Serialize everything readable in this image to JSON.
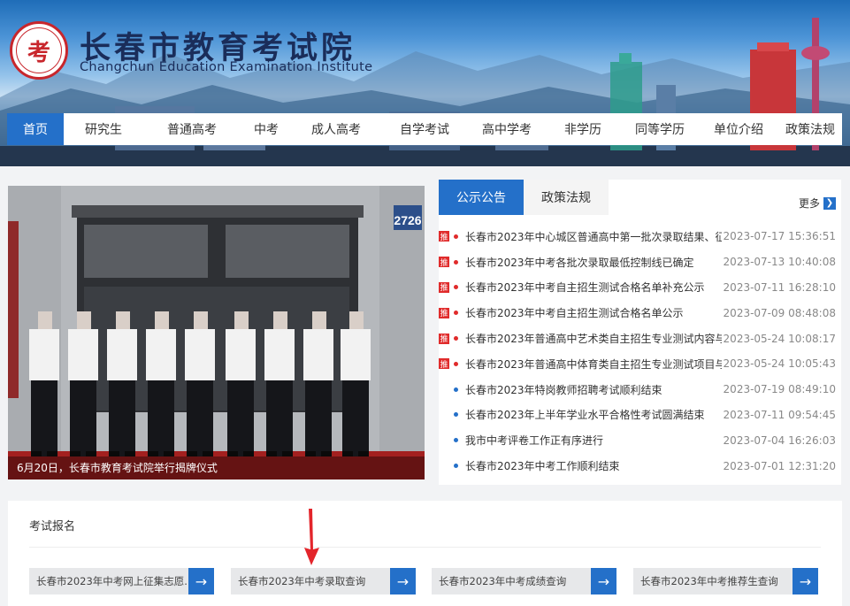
{
  "header": {
    "logo_glyph": "考",
    "site_name_cn": "长春市教育考试院",
    "site_name_en": "Changchun Education Examination Institute"
  },
  "nav": [
    {
      "label": "首页",
      "active": true
    },
    {
      "label": "研究生"
    },
    {
      "label": "普通高考"
    },
    {
      "label": "中考"
    },
    {
      "label": "成人高考"
    },
    {
      "label": "自学考试"
    },
    {
      "label": "高中学考"
    },
    {
      "label": "非学历"
    },
    {
      "label": "同等学历"
    },
    {
      "label": "单位介绍"
    },
    {
      "label": "政策法规"
    }
  ],
  "banner": {
    "caption": "6月20日，长春市教育考试院举行揭牌仪式",
    "door_number": "2726"
  },
  "news": {
    "tabs": [
      "公示公告",
      "政策法规"
    ],
    "active_tab": 0,
    "more_label": "更多",
    "more_icon": "chevron-right-icon",
    "badge_text": "推",
    "items": [
      {
        "title": "长春市2023年中心城区普通高中第一批次录取结果、征...",
        "date": "2023-07-17 15:36:51",
        "pinned": true
      },
      {
        "title": "长春市2023年中考各批次录取最低控制线已确定",
        "date": "2023-07-13 10:40:08",
        "pinned": true
      },
      {
        "title": "长春市2023年中考自主招生测试合格名单补充公示",
        "date": "2023-07-11 16:28:10",
        "pinned": true
      },
      {
        "title": "长春市2023年中考自主招生测试合格名单公示",
        "date": "2023-07-09 08:48:08",
        "pinned": true
      },
      {
        "title": "长春市2023年普通高中艺术类自主招生专业测试内容与...",
        "date": "2023-05-24 10:08:17",
        "pinned": true
      },
      {
        "title": "长春市2023年普通高中体育类自主招生专业测试项目与...",
        "date": "2023-05-24 10:05:43",
        "pinned": true
      },
      {
        "title": "长春市2023年特岗教师招聘考试顺利结束",
        "date": "2023-07-19 08:49:10",
        "pinned": false
      },
      {
        "title": "长春市2023年上半年学业水平合格性考试圆满结束",
        "date": "2023-07-11 09:54:45",
        "pinned": false
      },
      {
        "title": "我市中考评卷工作正有序进行",
        "date": "2023-07-04 16:26:03",
        "pinned": false
      },
      {
        "title": "长春市2023年中考工作顺利结束",
        "date": "2023-07-01 12:31:20",
        "pinned": false
      }
    ]
  },
  "exam": {
    "title": "考试报名",
    "buttons": [
      {
        "label": "长春市2023年中考网上征集志愿..."
      },
      {
        "label": "长春市2023年中考录取查询"
      },
      {
        "label": "长春市2023年中考成绩查询"
      },
      {
        "label": "长春市2023年中考推荐生查询"
      }
    ]
  },
  "colors": {
    "primary": "#2470c9",
    "pin_red": "#e02b2b",
    "annotation_arrow": "#e3252b"
  }
}
